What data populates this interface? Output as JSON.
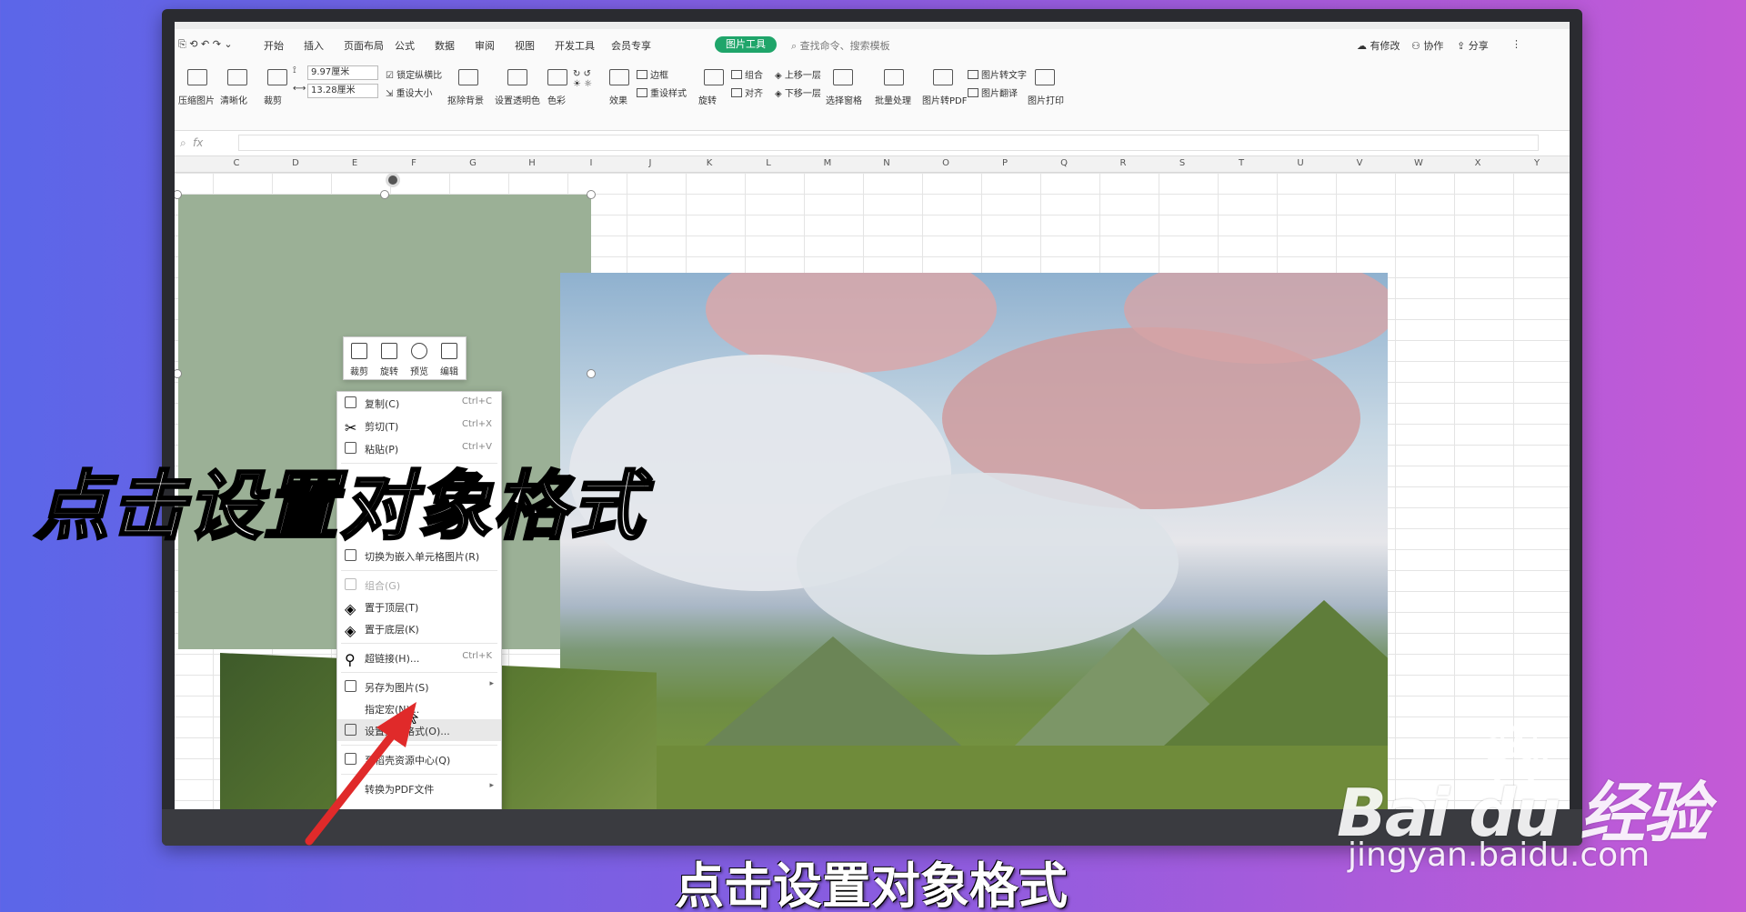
{
  "menu": {
    "items": [
      "开始",
      "插入",
      "页面布局",
      "公式",
      "数据",
      "审阅",
      "视图",
      "开发工具",
      "会员专享"
    ],
    "active_tab": "图片工具",
    "search_placeholder": "查找命令、搜索模板",
    "right": [
      "有修改",
      "协作",
      "分享"
    ]
  },
  "ribbon": {
    "compress": "压缩图片",
    "clarity": "清晰化",
    "crop": "裁剪",
    "height": "9.97厘米",
    "width": "13.28厘米",
    "lock_ratio": "锁定纵横比",
    "reset_size": "重设大小",
    "remove_bg": "抠除背景",
    "transparency": "设置透明色",
    "color": "色彩",
    "effect": "效果",
    "border": "边框",
    "reset_style": "重设样式",
    "rotate": "旋转",
    "group": "组合",
    "align": "对齐",
    "bring_forward": "上移一层",
    "send_backward": "下移一层",
    "selection_pane": "选择窗格",
    "batch": "批量处理",
    "to_pdf": "图片转PDF",
    "to_text": "图片转文字",
    "translate": "图片翻译",
    "print": "图片打印"
  },
  "formula_bar": {
    "fx": "fx"
  },
  "columns": [
    "C",
    "D",
    "E",
    "F",
    "G",
    "H",
    "I",
    "J",
    "K",
    "L",
    "M",
    "N",
    "O",
    "P",
    "Q",
    "R",
    "S",
    "T",
    "U",
    "V",
    "W",
    "X",
    "Y"
  ],
  "float_toolbar": [
    {
      "label": "裁剪",
      "icon": "crop-icon"
    },
    {
      "label": "旋转",
      "icon": "rotate-icon"
    },
    {
      "label": "预览",
      "icon": "zoom-icon"
    },
    {
      "label": "编辑",
      "icon": "edit-icon"
    }
  ],
  "context_menu": [
    {
      "label": "复制(C)",
      "shortcut": "Ctrl+C"
    },
    {
      "label": "剪切(T)",
      "shortcut": "Ctrl+X"
    },
    {
      "label": "粘贴(P)",
      "shortcut": "Ctrl+V"
    },
    {
      "label": "切换为嵌入单元格图片(R)",
      "shortcut": ""
    },
    {
      "label": "组合(G)",
      "shortcut": ""
    },
    {
      "label": "置于顶层(T)",
      "shortcut": ""
    },
    {
      "label": "置于底层(K)",
      "shortcut": ""
    },
    {
      "label": "超链接(H)...",
      "shortcut": "Ctrl+K"
    },
    {
      "label": "另存为图片(S)",
      "shortcut": ""
    },
    {
      "label": "指定宏(N)...",
      "shortcut": ""
    },
    {
      "label": "设置对象格式(O)...",
      "shortcut": ""
    },
    {
      "label": "至稻壳资源中心(Q)",
      "shortcut": ""
    },
    {
      "label": "转换为PDF文件",
      "shortcut": ""
    }
  ],
  "overlay_caption": "点击设置对象格式",
  "subtitle": "点击设置对象格式",
  "watermark": {
    "brand": "Bai du 经验",
    "url": "jingyan.baidu.com"
  },
  "colors": {
    "accent": "#1fa56a",
    "panel": "#9bb096"
  }
}
